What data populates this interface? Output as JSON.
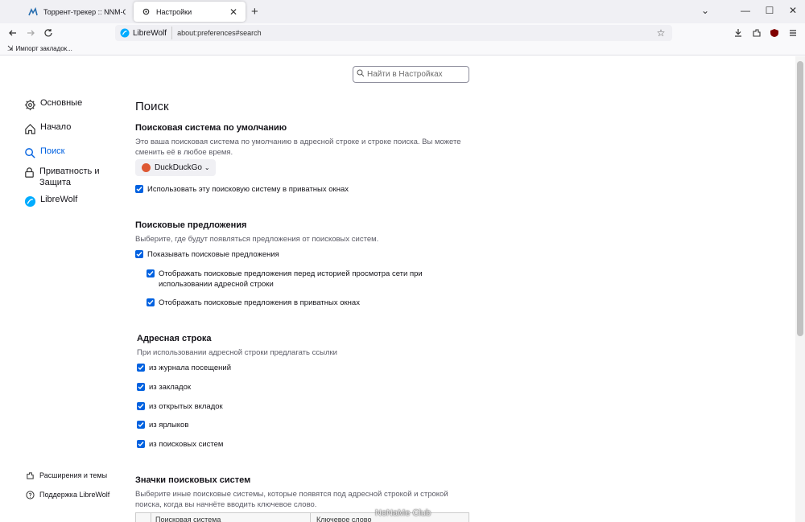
{
  "tabs": [
    {
      "title": "Торрент-трекер :: NNM-Club"
    },
    {
      "title": "Настройки"
    }
  ],
  "urlbar": {
    "identity_label": "LibreWolf",
    "url": "about:preferences#search"
  },
  "bookmarks": {
    "import_label": "Импорт закладок..."
  },
  "search_settings": {
    "placeholder": "Найти в Настройках"
  },
  "sidebar": {
    "items": [
      {
        "label": "Основные",
        "icon": "gear-icon"
      },
      {
        "label": "Начало",
        "icon": "home-icon"
      },
      {
        "label": "Поиск",
        "icon": "search-icon"
      },
      {
        "label": "Приватность и Защита",
        "icon": "lock-icon"
      },
      {
        "label": "LibreWolf",
        "icon": "librewolf-icon"
      }
    ],
    "footer": [
      {
        "label": "Расширения и темы",
        "icon": "puzzle-icon"
      },
      {
        "label": "Поддержка LibreWolf",
        "icon": "help-icon"
      }
    ]
  },
  "main": {
    "title": "Поиск",
    "default_engine": {
      "heading": "Поисковая система по умолчанию",
      "description": "Это ваша поисковая система по умолчанию в адресной строке и строке поиска. Вы можете сменить её в любое время.",
      "selected": "DuckDuckGo",
      "private_checkbox": "Использовать эту поисковую систему в приватных окнах"
    },
    "suggestions": {
      "heading": "Поисковые предложения",
      "description": "Выберите, где будут появляться предложения от поисковых систем.",
      "show": "Показывать поисковые предложения",
      "before_history": "Отображать поисковые предложения перед историей просмотра сети при использовании адресной строки",
      "private": "Отображать поисковые предложения в приватных окнах"
    },
    "address_bar": {
      "heading": "Адресная строка",
      "description": "При использовании адресной строки предлагать ссылки",
      "options": [
        "из журнала посещений",
        "из закладок",
        "из открытых вкладок",
        "из ярлыков",
        "из поисковых систем"
      ]
    },
    "shortcuts": {
      "heading": "Значки поисковых систем",
      "description": "Выберите иные поисковые системы, которые появятся под адресной строкой и строкой поиска, когда вы начнёте вводить ключевое слово.",
      "col_engine": "Поисковая система",
      "col_keyword": "Ключевое слово"
    }
  },
  "watermark": "NoNaMe Club",
  "colors": {
    "accent": "#0061e0",
    "tabstrip": "#f0f0f4"
  }
}
